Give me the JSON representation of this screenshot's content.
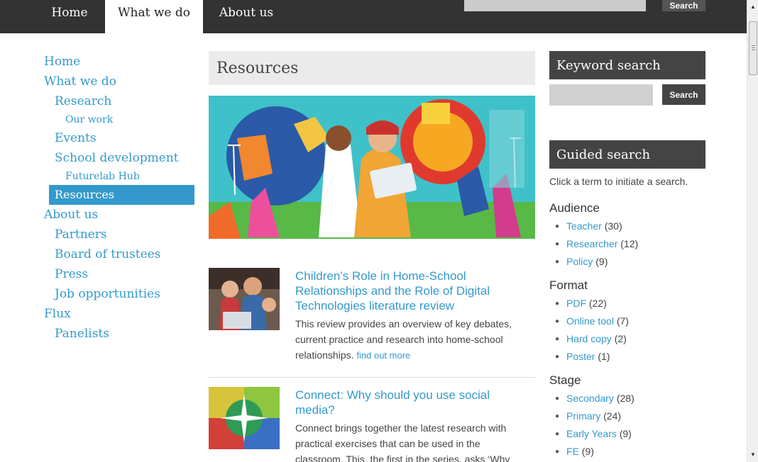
{
  "top_nav": {
    "tabs": [
      {
        "label": "Home"
      },
      {
        "label": "What we do"
      },
      {
        "label": "About us"
      }
    ],
    "search_button": "Search"
  },
  "left_nav": {
    "items": [
      {
        "label": "Home"
      },
      {
        "label": "What we do"
      },
      {
        "label": "Research"
      },
      {
        "label": "Our work"
      },
      {
        "label": "Events"
      },
      {
        "label": "School development"
      },
      {
        "label": "Futurelab Hub"
      },
      {
        "label": "Resources"
      },
      {
        "label": "About us"
      },
      {
        "label": "Partners"
      },
      {
        "label": "Board of trustees"
      },
      {
        "label": "Press"
      },
      {
        "label": "Job opportunities"
      },
      {
        "label": "Flux"
      },
      {
        "label": "Panelists"
      }
    ]
  },
  "main": {
    "page_title": "Resources",
    "articles": [
      {
        "title": "Children’s Role in Home-School Relationships and the Role of Digital Technologies literature review",
        "summary": "This review provides an overview of key debates, current practice and research into home-school relationships.",
        "more": "find out more"
      },
      {
        "title": "Connect: Why should you use social media?",
        "summary": "Connect brings together the latest research with practical exercises that can be used in the classroom. This, the first in the series, asks ‘Why"
      }
    ]
  },
  "sidebar": {
    "keyword_title": "Keyword search",
    "keyword_button": "Search",
    "guided_title": "Guided search",
    "guided_hint": "Click a term to initiate a search.",
    "facets": [
      {
        "heading": "Audience",
        "items": [
          {
            "label": "Teacher",
            "count": "(30)"
          },
          {
            "label": "Researcher",
            "count": "(12)"
          },
          {
            "label": "Policy",
            "count": "(9)"
          }
        ]
      },
      {
        "heading": "Format",
        "items": [
          {
            "label": "PDF",
            "count": "(22)"
          },
          {
            "label": "Online tool",
            "count": "(7)"
          },
          {
            "label": "Hard copy",
            "count": "(2)"
          },
          {
            "label": "Poster",
            "count": "(1)"
          }
        ]
      },
      {
        "heading": "Stage",
        "items": [
          {
            "label": "Secondary",
            "count": "(28)"
          },
          {
            "label": "Primary",
            "count": "(24)"
          },
          {
            "label": "Early Years",
            "count": "(9)"
          },
          {
            "label": "FE",
            "count": "(9)"
          }
        ]
      }
    ]
  },
  "colors": {
    "accent": "#3399cc",
    "topbar": "#333333",
    "sidebar_header": "#444444"
  }
}
